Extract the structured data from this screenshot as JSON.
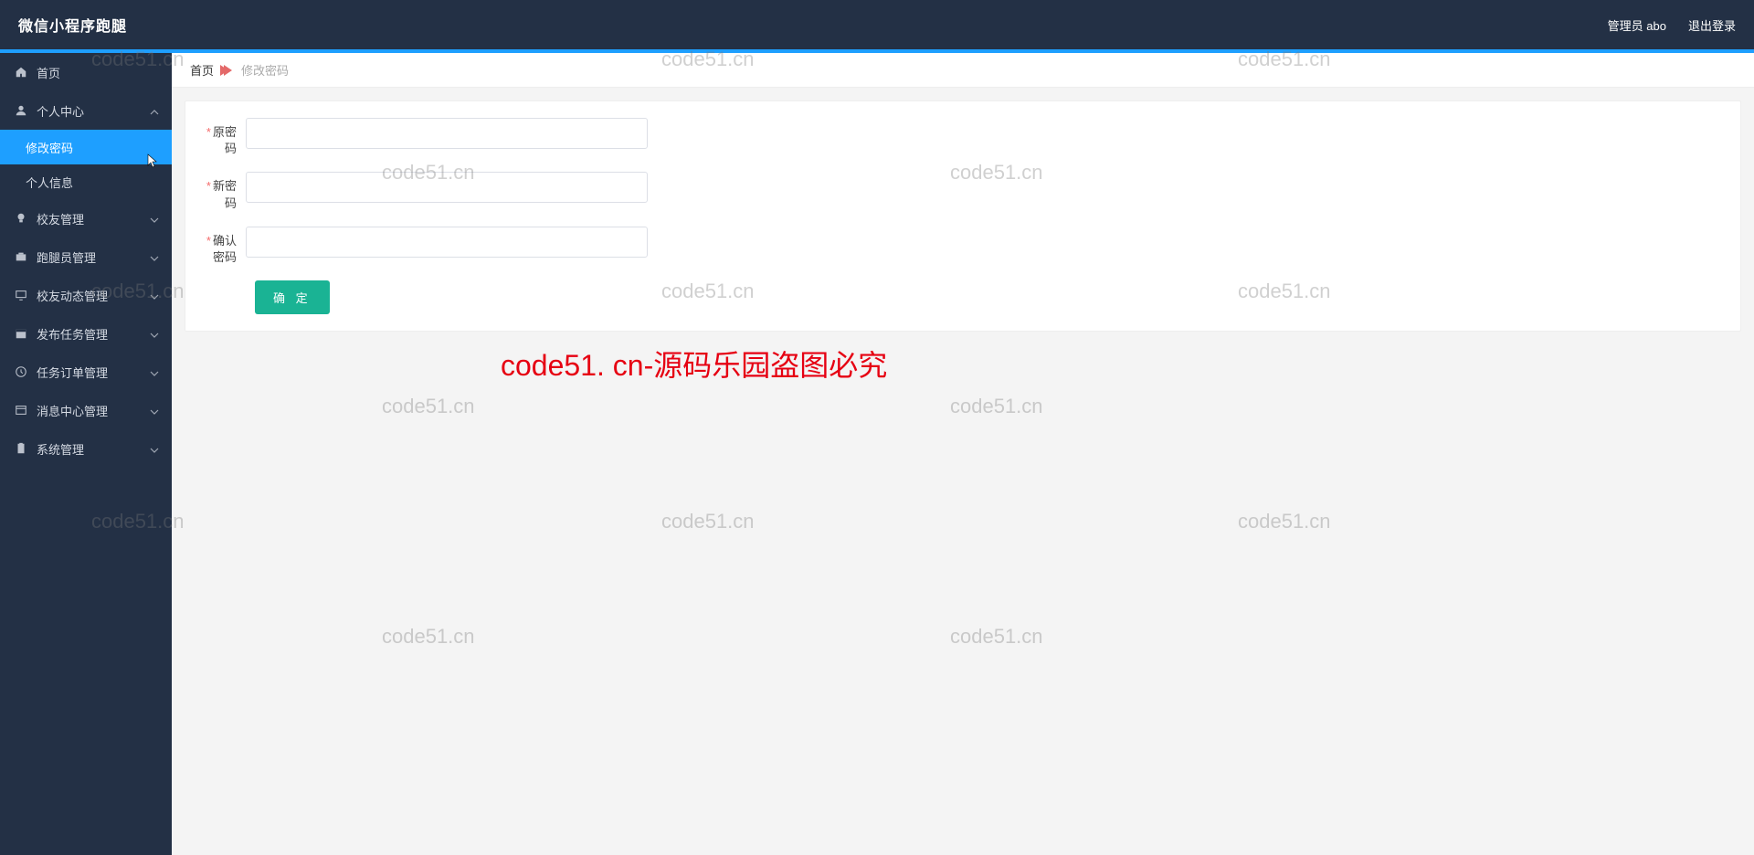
{
  "header": {
    "title": "微信小程序跑腿",
    "admin_label": "管理员 abo",
    "logout": "退出登录"
  },
  "sidebar": {
    "home": "首页",
    "personal": {
      "label": "个人中心",
      "children": {
        "change_pwd": "修改密码",
        "personal_info": "个人信息"
      }
    },
    "alumni_mgmt": "校友管理",
    "runner_mgmt": "跑腿员管理",
    "alumni_news_mgmt": "校友动态管理",
    "task_pub_mgmt": "发布任务管理",
    "task_order_mgmt": "任务订单管理",
    "msg_center_mgmt": "消息中心管理",
    "sys_mgmt": "系统管理"
  },
  "breadcrumb": {
    "home": "首页",
    "current": "修改密码"
  },
  "form": {
    "old_pwd": "原密码",
    "new_pwd": "新密码",
    "confirm_pwd": "确认密码",
    "submit": "确 定"
  },
  "watermark": {
    "text": "code51.cn",
    "center_text": "code51. cn-源码乐园盗图必究"
  }
}
